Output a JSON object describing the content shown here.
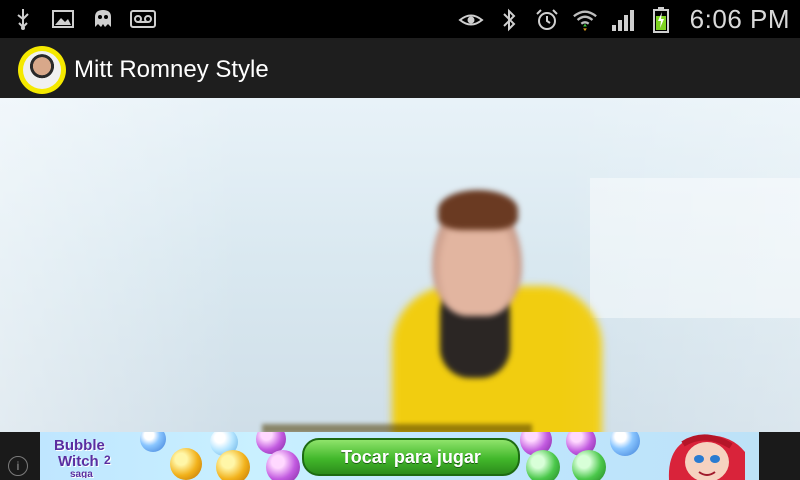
{
  "status_bar": {
    "left_icons": [
      "usb-icon",
      "image-icon",
      "ghost-icon",
      "voicemail-icon"
    ],
    "right_icons": [
      "eye-icon",
      "bluetooth-icon",
      "alarm-icon",
      "wifi-icon",
      "signal-icon",
      "battery-icon"
    ],
    "time": "6:06 PM"
  },
  "action_bar": {
    "title": "Mitt Romney Style"
  },
  "ad": {
    "logo_text": "Bubble Witch 2 Saga",
    "cta_label": "Tocar para jugar"
  },
  "colors": {
    "status_bg": "#000000",
    "actionbar_bg": "#1e1e1e",
    "icon_yellow": "#f5e900",
    "cta_green": "#42b82b"
  }
}
